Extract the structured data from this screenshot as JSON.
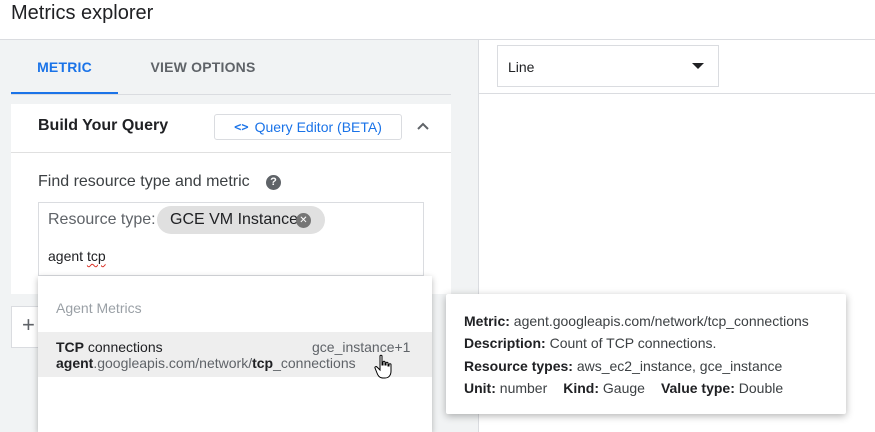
{
  "page": {
    "title": "Metrics explorer"
  },
  "tabs": {
    "metric": "METRIC",
    "view_options": "VIEW OPTIONS"
  },
  "query_card": {
    "title": "Build Your Query",
    "query_editor_label": "Query Editor (BETA)",
    "query_editor_icon": "code-icon",
    "find_label": "Find resource type and metric",
    "resource_type_label": "Resource type:",
    "resource_chip": "GCE VM Instance",
    "search_value_plain": "agent",
    "search_value_spelled": "tcp"
  },
  "dropdown": {
    "header": "Agent Metrics",
    "items": [
      {
        "name_bold": "TCP",
        "name_rest": " connections",
        "resource": "gce_instance+1",
        "path_parts": [
          "agent",
          ".googleapis.com/network/",
          "tcp",
          "_connections"
        ]
      }
    ]
  },
  "chart_type": {
    "selected": "Line"
  },
  "tooltip": {
    "metric_label": "Metric:",
    "metric_value": "agent.googleapis.com/network/tcp_connections",
    "description_label": "Description:",
    "description_value": "Count of TCP connections.",
    "resource_types_label": "Resource types:",
    "resource_types_value": "aws_ec2_instance, gce_instance",
    "unit_label": "Unit:",
    "unit_value": "number",
    "kind_label": "Kind:",
    "kind_value": "Gauge",
    "value_type_label": "Value type:",
    "value_type_value": "Double"
  },
  "colors": {
    "accent": "#1a73e8",
    "panel_bg": "#f1f3f4",
    "chip_bg": "#e0e0e0"
  }
}
